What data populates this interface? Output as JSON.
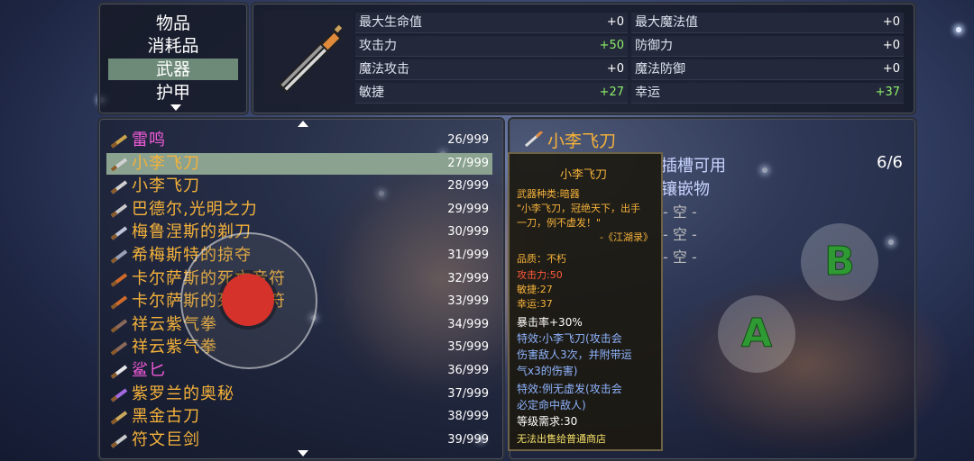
{
  "categories": {
    "items": [
      "物品",
      "消耗品",
      "武器",
      "护甲"
    ],
    "selected_index": 2
  },
  "selected_item": {
    "title": "小李飞刀",
    "stats": [
      {
        "label": "最大生命值",
        "value": "+0",
        "highlight": false
      },
      {
        "label": "最大魔法值",
        "value": "+0",
        "highlight": false
      },
      {
        "label": "攻击力",
        "value": "+50",
        "highlight": true
      },
      {
        "label": "防御力",
        "value": "+0",
        "highlight": false
      },
      {
        "label": "魔法攻击",
        "value": "+0",
        "highlight": false
      },
      {
        "label": "魔法防御",
        "value": "+0",
        "highlight": false
      },
      {
        "label": "敏捷",
        "value": "+27",
        "highlight": true
      },
      {
        "label": "幸运",
        "value": "+37",
        "highlight": true
      }
    ]
  },
  "inventory": {
    "selected_index": 1,
    "items": [
      {
        "name": "雷鸣",
        "count": "26/999",
        "color": "pink",
        "icon": "gun-icon"
      },
      {
        "name": "小李飞刀",
        "count": "27/999",
        "color": "orange",
        "icon": "knife-icon"
      },
      {
        "name": "小李飞刀",
        "count": "28/999",
        "color": "orange",
        "icon": "knife-icon"
      },
      {
        "name": "巴德尔,光明之力",
        "count": "29/999",
        "color": "orange",
        "icon": "hammer-icon"
      },
      {
        "name": "梅鲁涅斯的剃刀",
        "count": "30/999",
        "color": "orange",
        "icon": "sword-icon"
      },
      {
        "name": "希梅斯特的掠夺",
        "count": "31/999",
        "color": "orange",
        "icon": "axe-icon"
      },
      {
        "name": "卡尔萨斯的死亡音符",
        "count": "32/999",
        "color": "orange",
        "icon": "staff-icon"
      },
      {
        "name": "卡尔萨斯的死亡音符",
        "count": "33/999",
        "color": "orange",
        "icon": "staff-icon"
      },
      {
        "name": "祥云紫气拳",
        "count": "34/999",
        "color": "orange",
        "icon": "fist-icon"
      },
      {
        "name": "祥云紫气拳",
        "count": "35/999",
        "color": "orange",
        "icon": "fist-icon"
      },
      {
        "name": "鲨匕",
        "count": "36/999",
        "color": "pink",
        "icon": "tooth-icon"
      },
      {
        "name": "紫罗兰的奥秘",
        "count": "37/999",
        "color": "orange",
        "icon": "spear-icon"
      },
      {
        "name": "黑金古刀",
        "count": "38/999",
        "color": "orange",
        "icon": "blade-icon"
      },
      {
        "name": "符文巨剑",
        "count": "39/999",
        "color": "orange",
        "icon": "greatsword-icon"
      }
    ]
  },
  "detail": {
    "header": "小李飞刀",
    "slots_label": "插槽可用",
    "slots_count": "6/6",
    "inlay_label": "镶嵌物",
    "empty_slots": [
      "- 空 -",
      "- 空 -",
      "- 空 -"
    ]
  },
  "tooltip": {
    "name": "小李飞刀",
    "type": "武器种类:暗器",
    "desc1": "\"小李飞刀，冠绝天下，出手",
    "desc2": "一刀，例不虚发！\"",
    "source": "-《江湖录》",
    "quality": "品质：不朽",
    "attack": "攻击力:50",
    "agility": "敏捷:27",
    "luck": "幸运:37",
    "crit": "暴击率+30%",
    "effect1_a": "特效:小李飞刀(攻击会",
    "effect1_b": "伤害敌人3次，并附带运",
    "effect1_c": "气x3的伤害)",
    "effect2_a": "特效:例无虚发(攻击会",
    "effect2_b": "必定命中敌人)",
    "level": "等级需求:30",
    "shop": "无法出售给普通商店"
  },
  "controls": {
    "a_label": "A",
    "b_label": "B"
  },
  "colors": {
    "orange": "#f5b23a",
    "pink": "#f05ad8",
    "green_value": "#8ff06a",
    "selected_row": "#8aa28f",
    "selected_category": "#6d8a78"
  }
}
